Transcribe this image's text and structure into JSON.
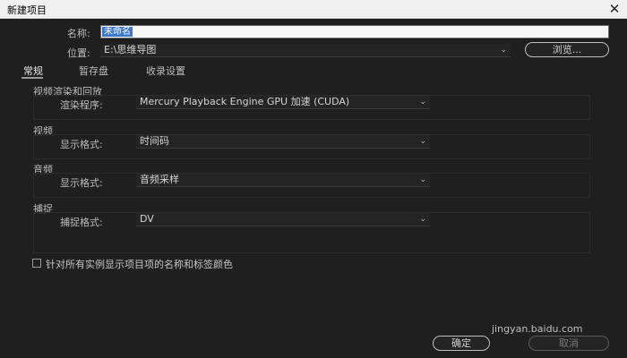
{
  "window": {
    "title": "新建项目",
    "close_glyph": "✕"
  },
  "fields": {
    "name_label": "名称:",
    "name_value": "未命名",
    "location_label": "位置:",
    "location_value": "E:\\思维导图",
    "browse_label": "浏览..."
  },
  "tabs": [
    "常规",
    "暂存盘",
    "收录设置"
  ],
  "sections": {
    "playback": {
      "title": "视频渲染和回放",
      "row_label": "渲染程序:",
      "value": "Mercury Playback Engine GPU 加速 (CUDA)"
    },
    "video": {
      "title": "视频",
      "row_label": "显示格式:",
      "value": "时间码"
    },
    "audio": {
      "title": "音频",
      "row_label": "显示格式:",
      "value": "音频采样"
    },
    "capture": {
      "title": "捕捉",
      "row_label": "捕捉格式:",
      "value": "DV"
    }
  },
  "checkbox_label": "针对所有实例显示项目项的名称和标签颜色",
  "buttons": {
    "ok": "确定",
    "cancel": "取消"
  },
  "watermark": "jingyan.baidu.com",
  "icons": {
    "dropdown": "chevron-down-icon",
    "close": "close-icon"
  }
}
